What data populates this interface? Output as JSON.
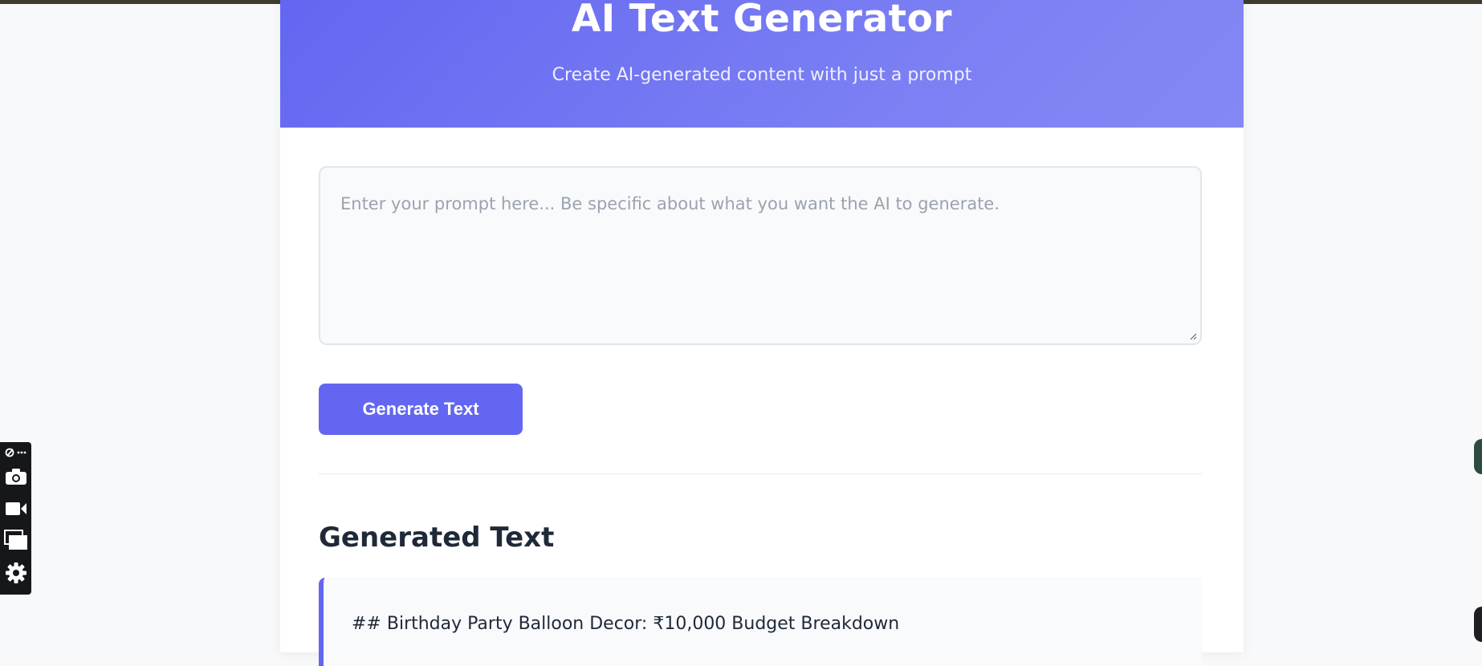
{
  "header": {
    "title": "AI Text Generator",
    "subtitle": "Create AI-generated content with just a prompt"
  },
  "prompt": {
    "placeholder": "Enter your prompt here... Be specific about what you want the AI to generate."
  },
  "actions": {
    "generate_label": "Generate Text"
  },
  "result": {
    "heading": "Generated Text",
    "first_line": "## Birthday Party Balloon Decor: ₹10,000 Budget Breakdown"
  },
  "capture_toolbar": {
    "icons": [
      "pin-icon",
      "more-icon",
      "camera-icon",
      "video-icon",
      "window-icon",
      "gear-icon"
    ]
  },
  "colors": {
    "accent": "#6366f1",
    "header_gradient_end": "#8488f5",
    "heading_text": "#1f2937",
    "placeholder_text": "#9aa3af"
  }
}
